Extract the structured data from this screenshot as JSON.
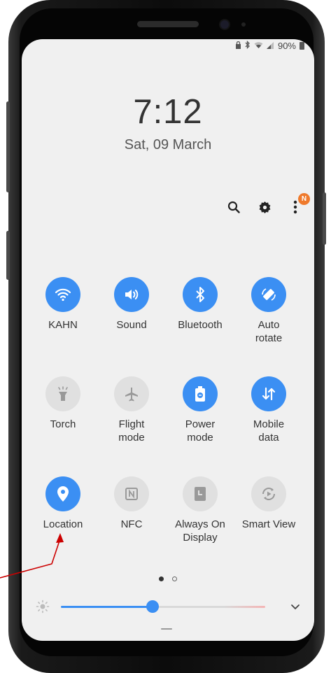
{
  "status_bar": {
    "battery": "90%"
  },
  "clock": {
    "time": "7:12",
    "date": "Sat, 09 March"
  },
  "toolbar": {
    "notification_badge": "N"
  },
  "tiles": [
    {
      "label": "KAHN",
      "state": "on",
      "icon": "wifi-icon"
    },
    {
      "label": "Sound",
      "state": "on",
      "icon": "sound-icon"
    },
    {
      "label": "Bluetooth",
      "state": "on",
      "icon": "bluetooth-icon"
    },
    {
      "label": "Auto\nrotate",
      "state": "on",
      "icon": "auto-rotate-icon"
    },
    {
      "label": "Torch",
      "state": "off",
      "icon": "torch-icon"
    },
    {
      "label": "Flight\nmode",
      "state": "off",
      "icon": "airplane-icon"
    },
    {
      "label": "Power\nmode",
      "state": "on",
      "icon": "power-mode-icon"
    },
    {
      "label": "Mobile\ndata",
      "state": "on",
      "icon": "mobile-data-icon"
    },
    {
      "label": "Location",
      "state": "on",
      "icon": "location-icon"
    },
    {
      "label": "NFC",
      "state": "off",
      "icon": "nfc-icon"
    },
    {
      "label": "Always On\nDisplay",
      "state": "off",
      "icon": "always-on-display-icon"
    },
    {
      "label": "Smart View",
      "state": "off",
      "icon": "smart-view-icon"
    }
  ],
  "pager": {
    "pages": 2,
    "current": 1
  },
  "brightness": {
    "level": 0.45
  },
  "colors": {
    "accent": "#3b8ff3",
    "inactive": "#e0e0e0",
    "annotation_arrow": "#cc0000",
    "badge": "#ef7a2c"
  }
}
